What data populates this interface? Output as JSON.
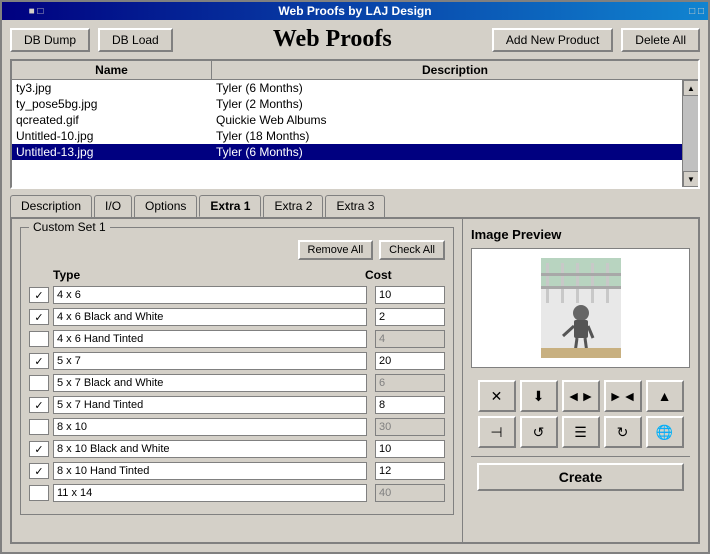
{
  "window": {
    "title": "Web Proofs by LAJ Design",
    "controls": [
      "minimize",
      "maximize",
      "close"
    ]
  },
  "toolbar": {
    "db_dump": "DB Dump",
    "db_load": "DB Load",
    "app_title": "Web Proofs",
    "add_new_product": "Add New Product",
    "delete_all": "Delete All"
  },
  "table": {
    "headers": [
      "Name",
      "Description"
    ],
    "rows": [
      {
        "name": "ty3.jpg",
        "description": "Tyler (6 Months)"
      },
      {
        "name": "ty_pose5bg.jpg",
        "description": "Tyler (2 Months)"
      },
      {
        "name": "qcreated.gif",
        "description": "Quickie Web Albums"
      },
      {
        "name": "Untitled-10.jpg",
        "description": "Tyler (18 Months)"
      },
      {
        "name": "Untitled-13.jpg",
        "description": "Tyler (6 Months)"
      }
    ],
    "selected_row": 4
  },
  "tabs": [
    {
      "label": "Description",
      "active": false
    },
    {
      "label": "I/O",
      "active": false
    },
    {
      "label": "Options",
      "active": false
    },
    {
      "label": "Extra 1",
      "active": true
    },
    {
      "label": "Extra 2",
      "active": false
    },
    {
      "label": "Extra 3",
      "active": false
    }
  ],
  "custom_set": {
    "label": "Custom Set 1",
    "remove_all": "Remove All",
    "check_all": "Check All",
    "col_type": "Type",
    "col_cost": "Cost",
    "products": [
      {
        "checked": true,
        "type": "4 x 6",
        "cost": "10",
        "disabled": false
      },
      {
        "checked": true,
        "type": "4 x 6 Black and White",
        "cost": "2",
        "disabled": false
      },
      {
        "checked": false,
        "type": "4 x 6 Hand Tinted",
        "cost": "4",
        "disabled": true
      },
      {
        "checked": true,
        "type": "5 x 7",
        "cost": "20",
        "disabled": false
      },
      {
        "checked": false,
        "type": "5 x 7 Black and White",
        "cost": "6",
        "disabled": true
      },
      {
        "checked": true,
        "type": "5 x 7 Hand Tinted",
        "cost": "8",
        "disabled": false
      },
      {
        "checked": false,
        "type": "8 x 10",
        "cost": "30",
        "disabled": true
      },
      {
        "checked": true,
        "type": "8 x 10 Black and White",
        "cost": "10",
        "disabled": false
      },
      {
        "checked": true,
        "type": "8 x 10 Hand Tinted",
        "cost": "12",
        "disabled": false
      },
      {
        "checked": false,
        "type": "11 x 14",
        "cost": "40",
        "disabled": true
      }
    ]
  },
  "image_preview": {
    "label": "Image Preview"
  },
  "icon_toolbar": {
    "row1": [
      "✕",
      "↓",
      "◄►",
      "►◄",
      "▲"
    ],
    "row2": [
      "⊣",
      "↺",
      "☰",
      "↻",
      "🌐"
    ]
  },
  "create_button": "Create"
}
